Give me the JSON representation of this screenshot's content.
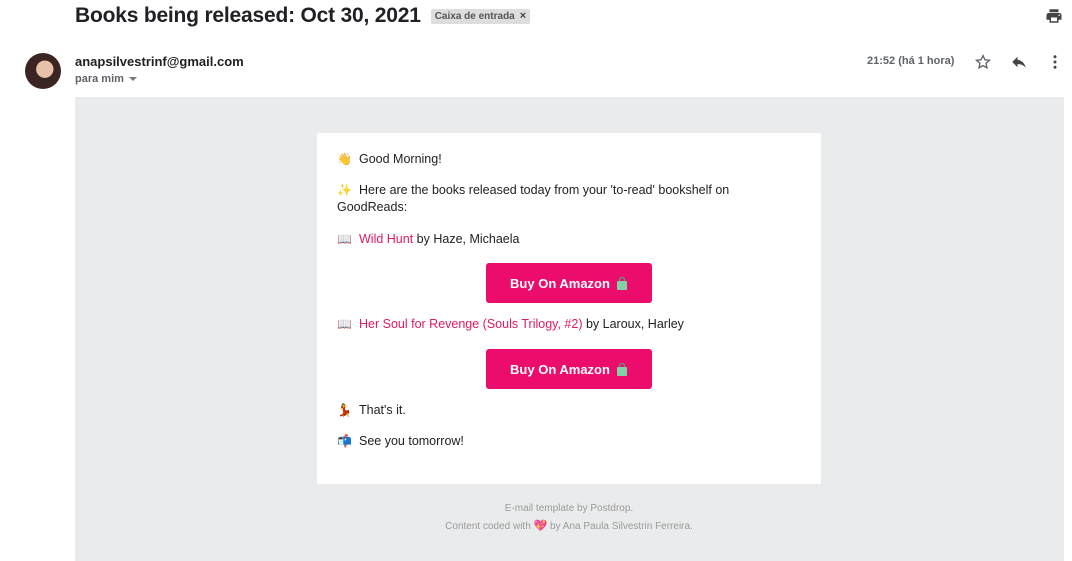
{
  "header": {
    "subject": "Books being released: Oct 30, 2021",
    "label_chip": "Caixa de entrada",
    "label_remove": "×"
  },
  "message": {
    "sender": "anapsilvestrinf@gmail.com",
    "recipient": "para mim",
    "time": "21:52 (há 1 hora)"
  },
  "email": {
    "greeting": "Good Morning!",
    "intro": "Here are the books released today from your 'to-read' bookshelf on GoodReads:",
    "books": [
      {
        "title": "Wild Hunt",
        "by": " by Haze, Michaela",
        "button": "Buy On Amazon"
      },
      {
        "title": "Her Soul for Revenge (Souls Trilogy, #2)",
        "by": " by Laroux, Harley",
        "button": "Buy On Amazon"
      }
    ],
    "closing": "That's it.",
    "farewell": "See you tomorrow!",
    "footer_line1": "E-mail template by Postdrop.",
    "footer_line2_pre": "Content coded with ",
    "footer_line2_post": " by Ana Paula Silvestrin Ferreira."
  },
  "icons": {
    "greeting": "👋",
    "intro": "✨",
    "book": "📖",
    "closing": "💃",
    "farewell": "📬",
    "heart": "💖"
  },
  "colors": {
    "accent": "#ec0c6b",
    "link": "#e5195f",
    "background": "#eaebec"
  }
}
